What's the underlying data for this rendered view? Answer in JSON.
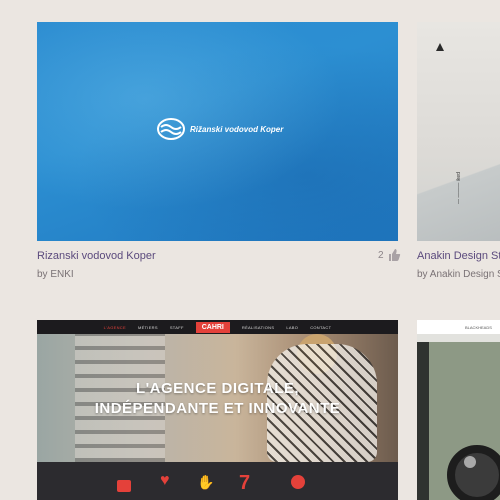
{
  "cards": [
    {
      "title": "Rizanski vodovod Koper",
      "byline": "by ENKI",
      "likes": "2",
      "thumb": {
        "logo_text": "Rižanski vodovod Koper",
        "colors": {
          "water": "#2a8bd0"
        }
      }
    },
    {
      "title": "Anakin Design St",
      "byline": "by Anakin Design S",
      "thumb": {
        "vertical_text": "— ——— iked"
      }
    },
    {
      "thumb": {
        "nav": [
          "L'AGENCE",
          "MÉTIERS",
          "STAFF",
          "CAHRI",
          "RÉALISATIONS",
          "LABO",
          "CONTACT"
        ],
        "headline_1": "L'AGENCE DIGITALE,",
        "headline_2": "INDÉPENDANTE ET INNOVANTE",
        "icon_number": "7",
        "colors": {
          "accent": "#e4413a",
          "dark": "#2c2b2f"
        }
      }
    },
    {
      "thumb": {
        "brand": "BLACKHEADS"
      }
    }
  ],
  "icons": {
    "like": "thumbs-up-icon",
    "logo_mark": "wave-logo-icon"
  }
}
